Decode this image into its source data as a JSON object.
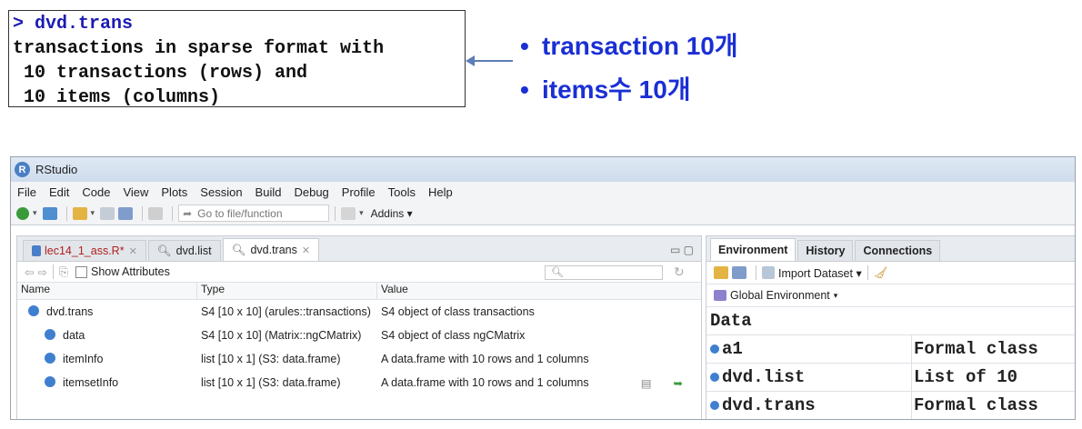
{
  "console": {
    "prompt": "> dvd.trans",
    "line1": "transactions in sparse format with",
    "line2": " 10 transactions (rows) and",
    "line3": " 10 items (columns)"
  },
  "bullets": [
    {
      "text": "transaction 10개"
    },
    {
      "text": "items수 10개"
    }
  ],
  "colors": {
    "bullet_text": "#1a2fd4",
    "accent_dot": "#3f7fcf",
    "arrow": "#5b7db8"
  },
  "rstudio": {
    "title": "RStudio",
    "menu": [
      "File",
      "Edit",
      "Code",
      "View",
      "Plots",
      "Session",
      "Build",
      "Debug",
      "Profile",
      "Tools",
      "Help"
    ],
    "toolbar": {
      "goto_placeholder": "Go to file/function",
      "addins": "Addins"
    },
    "editor_tabs": [
      {
        "label": "lec14_1_ass.R*",
        "icon": "r-file-icon"
      },
      {
        "label": "dvd.list",
        "icon": "search-icon"
      },
      {
        "label": "dvd.trans",
        "icon": "search-icon"
      }
    ],
    "show_attributes": "Show Attributes",
    "columns": {
      "name": "Name",
      "type": "Type",
      "value": "Value"
    },
    "rows": [
      {
        "name": "dvd.trans",
        "type": "S4 [10 x 10] (arules::transactions)",
        "value": "S4 object of class transactions"
      },
      {
        "name": "data",
        "type": "S4 [10 x 10] (Matrix::ngCMatrix)",
        "value": "S4 object of class ngCMatrix"
      },
      {
        "name": "itemInfo",
        "type": "list [10 x 1] (S3: data.frame)",
        "value": "A data.frame with 10 rows and 1 columns"
      },
      {
        "name": "itemsetInfo",
        "type": "list [10 x 1] (S3: data.frame)",
        "value": "A data.frame with 10 rows and 1 columns"
      }
    ],
    "right_tabs": [
      "Environment",
      "History",
      "Connections"
    ],
    "import_dataset": "Import Dataset",
    "global_env": "Global Environment",
    "env_section": "Data",
    "env_rows": [
      {
        "name": "a1",
        "value": "Formal class"
      },
      {
        "name": "dvd.list",
        "value": "List of 10"
      },
      {
        "name": "dvd.trans",
        "value": "Formal class"
      }
    ]
  }
}
